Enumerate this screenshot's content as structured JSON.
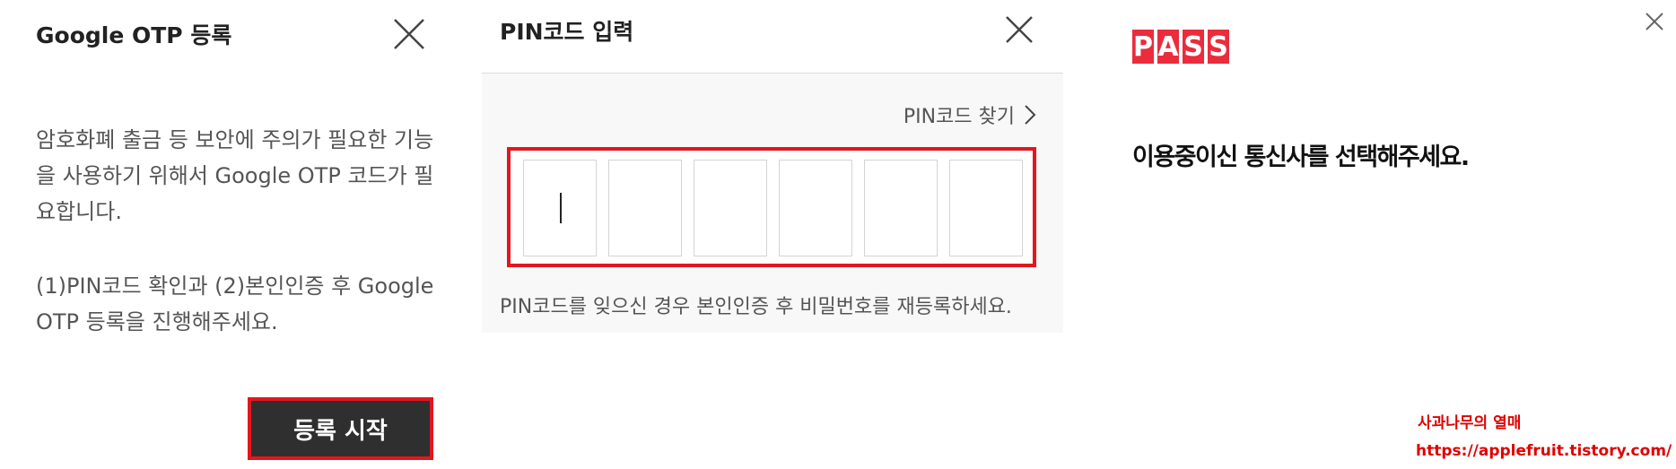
{
  "otp_panel": {
    "title": "Google OTP 등록",
    "paragraph1": "암호화폐 출금 등 보안에 주의가 필요한 기능을 사용하기 위해서 Google OTP 코드가 필요합니다.",
    "paragraph2": "(1)PIN코드 확인과 (2)본인인증 후 Google OTP 등록을 진행해주세요.",
    "start_button": "등록 시작",
    "icons": {
      "close": "close-icon"
    }
  },
  "pin_panel": {
    "title": "PIN코드 입력",
    "find_pin_link": "PIN코드 찾기",
    "pin_digits": [
      "",
      "",
      "",
      "",
      "",
      ""
    ],
    "note": "PIN코드를 잊으신 경우 본인인증 후 비밀번호를 재등록하세요.",
    "icons": {
      "close": "close-icon",
      "chevron": "chevron-right-icon"
    }
  },
  "pass_panel": {
    "logo": "PASS",
    "heading": "이용중이신 통신사를 선택해주세요.",
    "icons": {
      "close": "close-icon"
    }
  },
  "watermark": {
    "blog_name": "사과나무의 열매",
    "url": "https://applefruit.tistory.com/"
  },
  "colors": {
    "highlight_red": "#e3161f",
    "pass_red": "#ea2c3c",
    "dark_button": "#2f2f2f",
    "watermark_red": "#e00000"
  }
}
